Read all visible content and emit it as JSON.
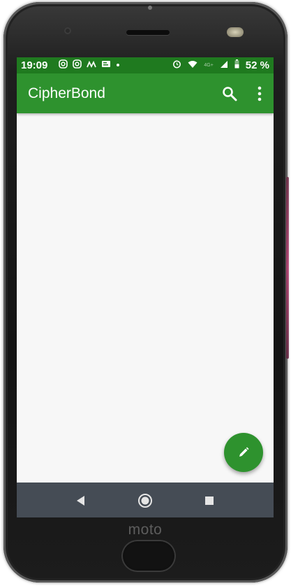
{
  "status_bar": {
    "time": "19:09",
    "notification_icons": [
      "instagram-icon",
      "instagram-icon",
      "signal-wave-icon",
      "message-icon",
      "dot-icon"
    ],
    "alarm_icon": "alarm-clock-icon",
    "wifi_icon": "wifi-icon",
    "network_label": "4G+",
    "cell_icon": "cell-signal-icon",
    "battery_icon": "battery-icon",
    "battery": "52 %"
  },
  "app_bar": {
    "title": "CipherBond",
    "search_icon": "search-icon",
    "more_icon": "more-vert-icon"
  },
  "fab": {
    "icon": "pencil-icon"
  },
  "nav_bar": {
    "back_icon": "back-triangle-icon",
    "home_icon": "home-circle-icon",
    "recents_icon": "recents-square-icon"
  },
  "device": {
    "brand": "moto"
  },
  "colors": {
    "status_bar": "#1f7a1f",
    "primary": "#2e922e",
    "background": "#f7f7f7",
    "nav_bar": "#454c55"
  }
}
